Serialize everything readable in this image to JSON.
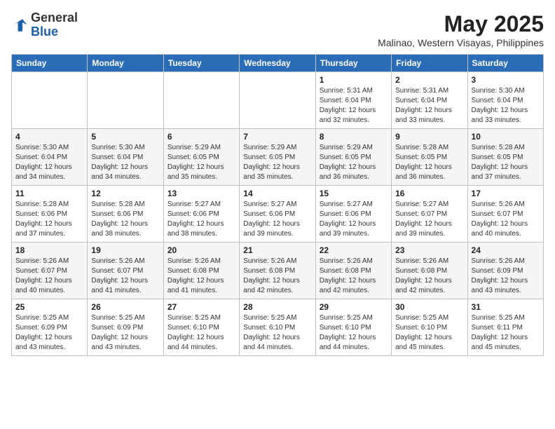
{
  "header": {
    "logo_line1": "General",
    "logo_line2": "Blue",
    "month": "May 2025",
    "location": "Malinao, Western Visayas, Philippines"
  },
  "days_of_week": [
    "Sunday",
    "Monday",
    "Tuesday",
    "Wednesday",
    "Thursday",
    "Friday",
    "Saturday"
  ],
  "weeks": [
    [
      {
        "num": "",
        "info": ""
      },
      {
        "num": "",
        "info": ""
      },
      {
        "num": "",
        "info": ""
      },
      {
        "num": "",
        "info": ""
      },
      {
        "num": "1",
        "info": "Sunrise: 5:31 AM\nSunset: 6:04 PM\nDaylight: 12 hours and 32 minutes."
      },
      {
        "num": "2",
        "info": "Sunrise: 5:31 AM\nSunset: 6:04 PM\nDaylight: 12 hours and 33 minutes."
      },
      {
        "num": "3",
        "info": "Sunrise: 5:30 AM\nSunset: 6:04 PM\nDaylight: 12 hours and 33 minutes."
      }
    ],
    [
      {
        "num": "4",
        "info": "Sunrise: 5:30 AM\nSunset: 6:04 PM\nDaylight: 12 hours and 34 minutes."
      },
      {
        "num": "5",
        "info": "Sunrise: 5:30 AM\nSunset: 6:04 PM\nDaylight: 12 hours and 34 minutes."
      },
      {
        "num": "6",
        "info": "Sunrise: 5:29 AM\nSunset: 6:05 PM\nDaylight: 12 hours and 35 minutes."
      },
      {
        "num": "7",
        "info": "Sunrise: 5:29 AM\nSunset: 6:05 PM\nDaylight: 12 hours and 35 minutes."
      },
      {
        "num": "8",
        "info": "Sunrise: 5:29 AM\nSunset: 6:05 PM\nDaylight: 12 hours and 36 minutes."
      },
      {
        "num": "9",
        "info": "Sunrise: 5:28 AM\nSunset: 6:05 PM\nDaylight: 12 hours and 36 minutes."
      },
      {
        "num": "10",
        "info": "Sunrise: 5:28 AM\nSunset: 6:05 PM\nDaylight: 12 hours and 37 minutes."
      }
    ],
    [
      {
        "num": "11",
        "info": "Sunrise: 5:28 AM\nSunset: 6:06 PM\nDaylight: 12 hours and 37 minutes."
      },
      {
        "num": "12",
        "info": "Sunrise: 5:28 AM\nSunset: 6:06 PM\nDaylight: 12 hours and 38 minutes."
      },
      {
        "num": "13",
        "info": "Sunrise: 5:27 AM\nSunset: 6:06 PM\nDaylight: 12 hours and 38 minutes."
      },
      {
        "num": "14",
        "info": "Sunrise: 5:27 AM\nSunset: 6:06 PM\nDaylight: 12 hours and 39 minutes."
      },
      {
        "num": "15",
        "info": "Sunrise: 5:27 AM\nSunset: 6:06 PM\nDaylight: 12 hours and 39 minutes."
      },
      {
        "num": "16",
        "info": "Sunrise: 5:27 AM\nSunset: 6:07 PM\nDaylight: 12 hours and 39 minutes."
      },
      {
        "num": "17",
        "info": "Sunrise: 5:26 AM\nSunset: 6:07 PM\nDaylight: 12 hours and 40 minutes."
      }
    ],
    [
      {
        "num": "18",
        "info": "Sunrise: 5:26 AM\nSunset: 6:07 PM\nDaylight: 12 hours and 40 minutes."
      },
      {
        "num": "19",
        "info": "Sunrise: 5:26 AM\nSunset: 6:07 PM\nDaylight: 12 hours and 41 minutes."
      },
      {
        "num": "20",
        "info": "Sunrise: 5:26 AM\nSunset: 6:08 PM\nDaylight: 12 hours and 41 minutes."
      },
      {
        "num": "21",
        "info": "Sunrise: 5:26 AM\nSunset: 6:08 PM\nDaylight: 12 hours and 42 minutes."
      },
      {
        "num": "22",
        "info": "Sunrise: 5:26 AM\nSunset: 6:08 PM\nDaylight: 12 hours and 42 minutes."
      },
      {
        "num": "23",
        "info": "Sunrise: 5:26 AM\nSunset: 6:08 PM\nDaylight: 12 hours and 42 minutes."
      },
      {
        "num": "24",
        "info": "Sunrise: 5:26 AM\nSunset: 6:09 PM\nDaylight: 12 hours and 43 minutes."
      }
    ],
    [
      {
        "num": "25",
        "info": "Sunrise: 5:25 AM\nSunset: 6:09 PM\nDaylight: 12 hours and 43 minutes."
      },
      {
        "num": "26",
        "info": "Sunrise: 5:25 AM\nSunset: 6:09 PM\nDaylight: 12 hours and 43 minutes."
      },
      {
        "num": "27",
        "info": "Sunrise: 5:25 AM\nSunset: 6:10 PM\nDaylight: 12 hours and 44 minutes."
      },
      {
        "num": "28",
        "info": "Sunrise: 5:25 AM\nSunset: 6:10 PM\nDaylight: 12 hours and 44 minutes."
      },
      {
        "num": "29",
        "info": "Sunrise: 5:25 AM\nSunset: 6:10 PM\nDaylight: 12 hours and 44 minutes."
      },
      {
        "num": "30",
        "info": "Sunrise: 5:25 AM\nSunset: 6:10 PM\nDaylight: 12 hours and 45 minutes."
      },
      {
        "num": "31",
        "info": "Sunrise: 5:25 AM\nSunset: 6:11 PM\nDaylight: 12 hours and 45 minutes."
      }
    ]
  ]
}
